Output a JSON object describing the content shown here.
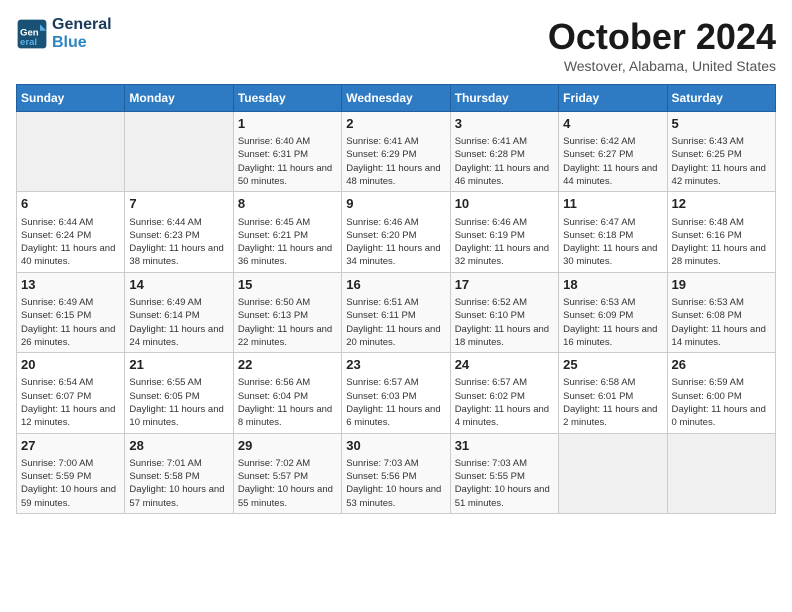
{
  "header": {
    "logo_line1": "General",
    "logo_line2": "Blue",
    "month_title": "October 2024",
    "location": "Westover, Alabama, United States"
  },
  "days_of_week": [
    "Sunday",
    "Monday",
    "Tuesday",
    "Wednesday",
    "Thursday",
    "Friday",
    "Saturday"
  ],
  "weeks": [
    [
      {
        "day": "",
        "info": ""
      },
      {
        "day": "",
        "info": ""
      },
      {
        "day": "1",
        "info": "Sunrise: 6:40 AM\nSunset: 6:31 PM\nDaylight: 11 hours and 50 minutes."
      },
      {
        "day": "2",
        "info": "Sunrise: 6:41 AM\nSunset: 6:29 PM\nDaylight: 11 hours and 48 minutes."
      },
      {
        "day": "3",
        "info": "Sunrise: 6:41 AM\nSunset: 6:28 PM\nDaylight: 11 hours and 46 minutes."
      },
      {
        "day": "4",
        "info": "Sunrise: 6:42 AM\nSunset: 6:27 PM\nDaylight: 11 hours and 44 minutes."
      },
      {
        "day": "5",
        "info": "Sunrise: 6:43 AM\nSunset: 6:25 PM\nDaylight: 11 hours and 42 minutes."
      }
    ],
    [
      {
        "day": "6",
        "info": "Sunrise: 6:44 AM\nSunset: 6:24 PM\nDaylight: 11 hours and 40 minutes."
      },
      {
        "day": "7",
        "info": "Sunrise: 6:44 AM\nSunset: 6:23 PM\nDaylight: 11 hours and 38 minutes."
      },
      {
        "day": "8",
        "info": "Sunrise: 6:45 AM\nSunset: 6:21 PM\nDaylight: 11 hours and 36 minutes."
      },
      {
        "day": "9",
        "info": "Sunrise: 6:46 AM\nSunset: 6:20 PM\nDaylight: 11 hours and 34 minutes."
      },
      {
        "day": "10",
        "info": "Sunrise: 6:46 AM\nSunset: 6:19 PM\nDaylight: 11 hours and 32 minutes."
      },
      {
        "day": "11",
        "info": "Sunrise: 6:47 AM\nSunset: 6:18 PM\nDaylight: 11 hours and 30 minutes."
      },
      {
        "day": "12",
        "info": "Sunrise: 6:48 AM\nSunset: 6:16 PM\nDaylight: 11 hours and 28 minutes."
      }
    ],
    [
      {
        "day": "13",
        "info": "Sunrise: 6:49 AM\nSunset: 6:15 PM\nDaylight: 11 hours and 26 minutes."
      },
      {
        "day": "14",
        "info": "Sunrise: 6:49 AM\nSunset: 6:14 PM\nDaylight: 11 hours and 24 minutes."
      },
      {
        "day": "15",
        "info": "Sunrise: 6:50 AM\nSunset: 6:13 PM\nDaylight: 11 hours and 22 minutes."
      },
      {
        "day": "16",
        "info": "Sunrise: 6:51 AM\nSunset: 6:11 PM\nDaylight: 11 hours and 20 minutes."
      },
      {
        "day": "17",
        "info": "Sunrise: 6:52 AM\nSunset: 6:10 PM\nDaylight: 11 hours and 18 minutes."
      },
      {
        "day": "18",
        "info": "Sunrise: 6:53 AM\nSunset: 6:09 PM\nDaylight: 11 hours and 16 minutes."
      },
      {
        "day": "19",
        "info": "Sunrise: 6:53 AM\nSunset: 6:08 PM\nDaylight: 11 hours and 14 minutes."
      }
    ],
    [
      {
        "day": "20",
        "info": "Sunrise: 6:54 AM\nSunset: 6:07 PM\nDaylight: 11 hours and 12 minutes."
      },
      {
        "day": "21",
        "info": "Sunrise: 6:55 AM\nSunset: 6:05 PM\nDaylight: 11 hours and 10 minutes."
      },
      {
        "day": "22",
        "info": "Sunrise: 6:56 AM\nSunset: 6:04 PM\nDaylight: 11 hours and 8 minutes."
      },
      {
        "day": "23",
        "info": "Sunrise: 6:57 AM\nSunset: 6:03 PM\nDaylight: 11 hours and 6 minutes."
      },
      {
        "day": "24",
        "info": "Sunrise: 6:57 AM\nSunset: 6:02 PM\nDaylight: 11 hours and 4 minutes."
      },
      {
        "day": "25",
        "info": "Sunrise: 6:58 AM\nSunset: 6:01 PM\nDaylight: 11 hours and 2 minutes."
      },
      {
        "day": "26",
        "info": "Sunrise: 6:59 AM\nSunset: 6:00 PM\nDaylight: 11 hours and 0 minutes."
      }
    ],
    [
      {
        "day": "27",
        "info": "Sunrise: 7:00 AM\nSunset: 5:59 PM\nDaylight: 10 hours and 59 minutes."
      },
      {
        "day": "28",
        "info": "Sunrise: 7:01 AM\nSunset: 5:58 PM\nDaylight: 10 hours and 57 minutes."
      },
      {
        "day": "29",
        "info": "Sunrise: 7:02 AM\nSunset: 5:57 PM\nDaylight: 10 hours and 55 minutes."
      },
      {
        "day": "30",
        "info": "Sunrise: 7:03 AM\nSunset: 5:56 PM\nDaylight: 10 hours and 53 minutes."
      },
      {
        "day": "31",
        "info": "Sunrise: 7:03 AM\nSunset: 5:55 PM\nDaylight: 10 hours and 51 minutes."
      },
      {
        "day": "",
        "info": ""
      },
      {
        "day": "",
        "info": ""
      }
    ]
  ]
}
